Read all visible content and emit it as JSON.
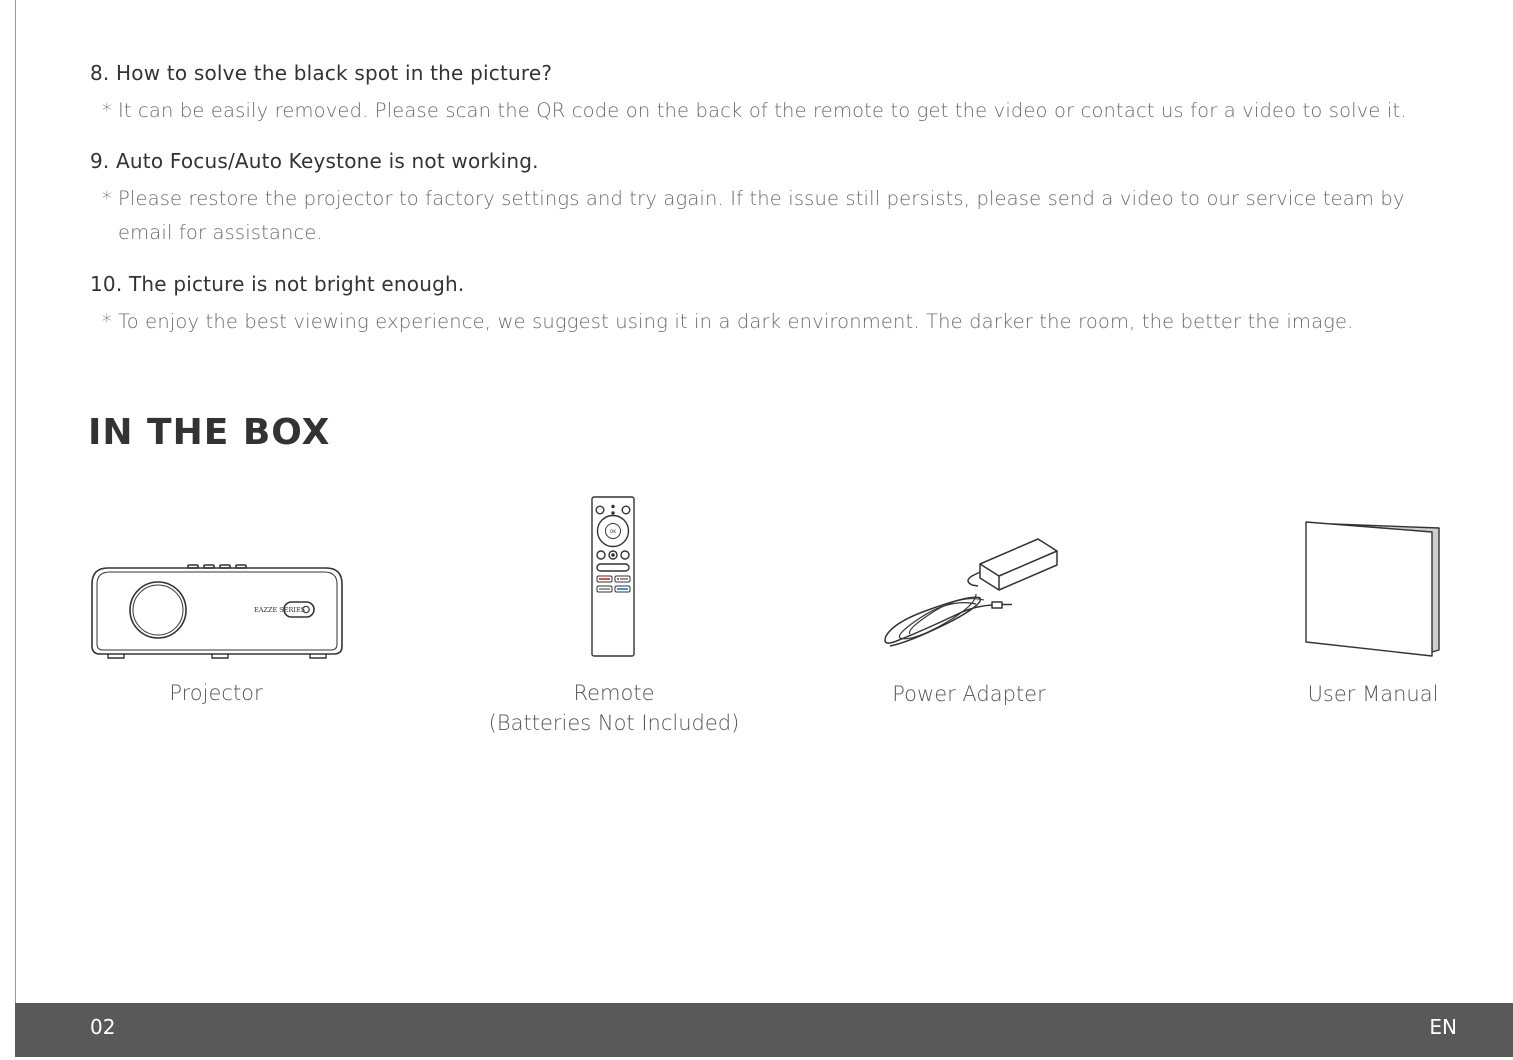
{
  "faq": [
    {
      "question": "8. How to solve the black spot in the picture?",
      "answer": "It can be easily removed. Please scan the QR code on the back of the remote to get the video or contact us for a video to solve it."
    },
    {
      "question": "9. Auto Focus/Auto Keystone is not working.",
      "answer": "Please restore the projector to factory settings and try again. If the issue still persists, please send a video to our service team by email for assistance."
    },
    {
      "question": "10. The picture is not bright enough.",
      "answer": "To enjoy the best viewing experience, we suggest using it in a dark environment. The darker the room, the better the image."
    }
  ],
  "answer_bullet": "*",
  "in_the_box": {
    "title": "IN THE BOX",
    "items": [
      {
        "label": "Projector",
        "icon": "projector-icon",
        "brand_text": "EAZZE SERIES"
      },
      {
        "label": "Remote",
        "sublabel": "(Batteries Not Included)",
        "icon": "remote-icon"
      },
      {
        "label": "Power Adapter",
        "icon": "power-adapter-icon"
      },
      {
        "label": "User Manual",
        "icon": "user-manual-icon"
      }
    ]
  },
  "footer": {
    "page_number": "02",
    "language": "EN"
  },
  "colors": {
    "footer_bar": "#5a5959",
    "remote_red_key": "#d9534f",
    "remote_blue_key": "#4a90d9"
  }
}
